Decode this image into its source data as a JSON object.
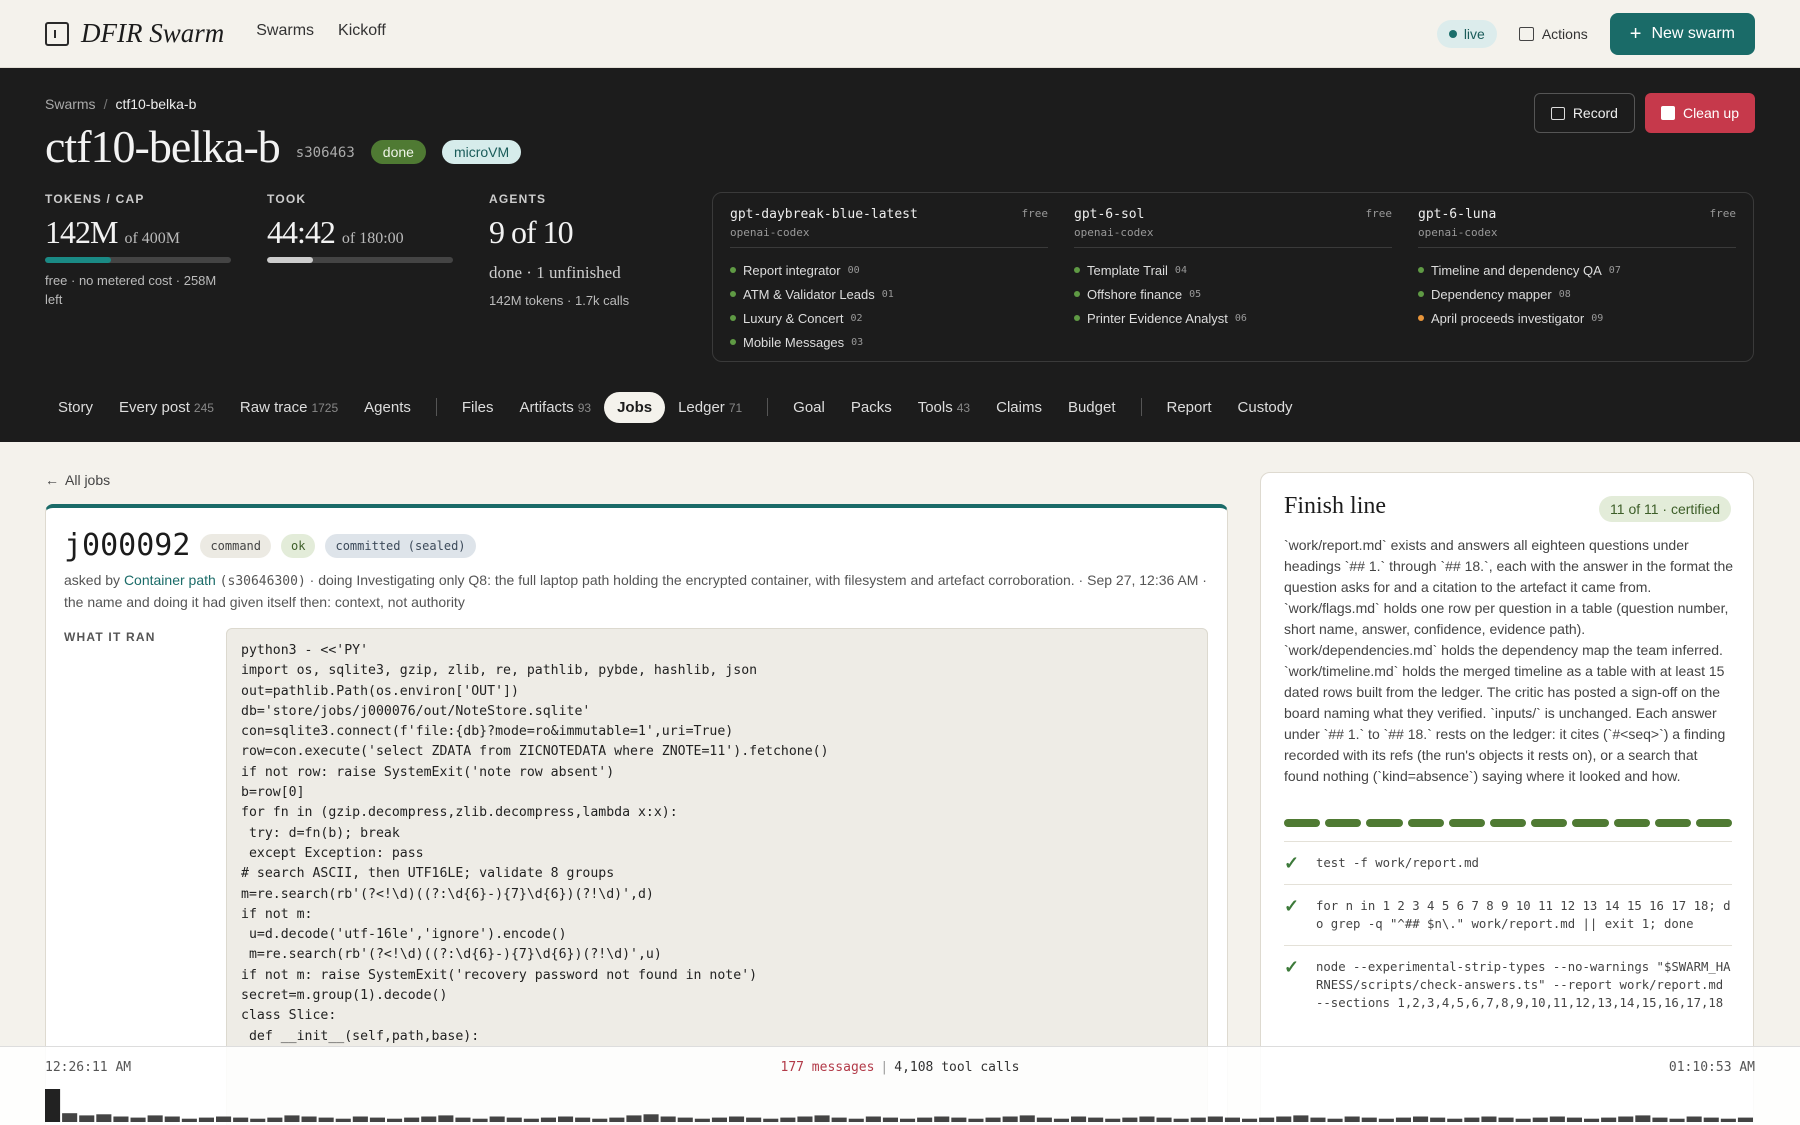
{
  "nav": {
    "logo": "DFIR Swarm",
    "links": [
      "Swarms",
      "Kickoff"
    ],
    "live": "live",
    "actions": "Actions",
    "new_swarm": "New swarm"
  },
  "hero": {
    "breadcrumb_root": "Swarms",
    "breadcrumb_sep": "/",
    "breadcrumb_current": "ctf10-belka-b",
    "title": "ctf10-belka-b",
    "swarm_id": "s306463",
    "status": "done",
    "runtime": "microVM",
    "record": "Record",
    "cleanup": "Clean up",
    "stats": {
      "tokens_label": "TOKENS / CAP",
      "tokens_value": "142M",
      "tokens_of": "of 400M",
      "tokens_fraction": 0.355,
      "tokens_sub": "free · no metered cost · 258M left",
      "took_label": "TOOK",
      "took_value": "44:42",
      "took_of": "of 180:00",
      "took_fraction": 0.248,
      "agents_label": "AGENTS",
      "agents_value": "9 of 10",
      "agents_sub": "done · 1 unfinished",
      "agents_sub2": "142M tokens · 1.7k calls"
    },
    "models": [
      {
        "name": "gpt-daybreak-blue-latest",
        "vendor": "openai-codex",
        "free": "free",
        "agents": [
          {
            "label": "Report integrator",
            "num": "00",
            "color": "#5f9a44"
          },
          {
            "label": "ATM & Validator Leads",
            "num": "01",
            "color": "#5f9a44"
          },
          {
            "label": "Luxury & Concert",
            "num": "02",
            "color": "#5f9a44"
          },
          {
            "label": "Mobile Messages",
            "num": "03",
            "color": "#5f9a44"
          }
        ]
      },
      {
        "name": "gpt-6-sol",
        "vendor": "openai-codex",
        "free": "free",
        "agents": [
          {
            "label": "Template Trail",
            "num": "04",
            "color": "#5f9a44"
          },
          {
            "label": "Offshore finance",
            "num": "05",
            "color": "#5f9a44"
          },
          {
            "label": "Printer Evidence Analyst",
            "num": "06",
            "color": "#5f9a44"
          }
        ]
      },
      {
        "name": "gpt-6-luna",
        "vendor": "openai-codex",
        "free": "free",
        "agents": [
          {
            "label": "Timeline and dependency QA",
            "num": "07",
            "color": "#5f9a44"
          },
          {
            "label": "Dependency mapper",
            "num": "08",
            "color": "#5f9a44"
          },
          {
            "label": "April proceeds investigator",
            "num": "09",
            "color": "#e8953a"
          }
        ]
      }
    ],
    "tabs": [
      {
        "label": "Story",
        "count": ""
      },
      {
        "label": "Every post",
        "count": "245"
      },
      {
        "label": "Raw trace",
        "count": "1725"
      },
      {
        "label": "Agents",
        "count": ""
      },
      {
        "sep": true
      },
      {
        "label": "Files",
        "count": ""
      },
      {
        "label": "Artifacts",
        "count": "93"
      },
      {
        "label": "Jobs",
        "count": "",
        "active": true
      },
      {
        "label": "Ledger",
        "count": "71"
      },
      {
        "sep": true
      },
      {
        "label": "Goal",
        "count": ""
      },
      {
        "label": "Packs",
        "count": ""
      },
      {
        "label": "Tools",
        "count": "43"
      },
      {
        "label": "Claims",
        "count": ""
      },
      {
        "label": "Budget",
        "count": ""
      },
      {
        "sep": true
      },
      {
        "label": "Report",
        "count": ""
      },
      {
        "label": "Custody",
        "count": ""
      }
    ]
  },
  "job": {
    "back": "All jobs",
    "id": "j000092",
    "kind": "command",
    "result": "ok",
    "state": "committed (sealed)",
    "meta_prefix": "asked by",
    "meta_agent": "Container path",
    "meta_agent_id": "(s30646300)",
    "meta_rest": "· doing Investigating only Q8: the full laptop path holding the encrypted container, with filesystem and artefact corroboration. · Sep 27, 12:36 AM · the name and doing it had given itself then: context, not authority",
    "ran_label": "WHAT IT RAN",
    "code": "python3 - <<'PY'\nimport os, sqlite3, gzip, zlib, re, pathlib, pybde, hashlib, json\nout=pathlib.Path(os.environ['OUT'])\ndb='store/jobs/j000076/out/NoteStore.sqlite'\ncon=sqlite3.connect(f'file:{db}?mode=ro&immutable=1',uri=True)\nrow=con.execute('select ZDATA from ZICNOTEDATA where ZNOTE=11').fetchone()\nif not row: raise SystemExit('note row absent')\nb=row[0]\nfor fn in (gzip.decompress,zlib.decompress,lambda x:x):\n try: d=fn(b); break\n except Exception: pass\n# search ASCII, then UTF16LE; validate 8 groups\nm=re.search(rb'(?<!\\d)((?:\\d{6}-){7}\\d{6})(?!\\d)',d)\nif not m:\n u=d.decode('utf-16le','ignore').encode()\n m=re.search(rb'(?<!\\d)((?:\\d{6}-){7}\\d{6})(?!\\d)',u)\nif not m: raise SystemExit('recovery password not found in note')\nsecret=m.group(1).decode()\nclass Slice:\n def __init__(self,path,base):"
  },
  "finish": {
    "title": "Finish line",
    "certified": "11 of 11 · certified",
    "text": "`work/report.md` exists and answers all eighteen questions under headings `## 1.` through `## 18.`, each with the answer in the format the question asks for and a citation to the artefact it came from. `work/flags.md` holds one row per question in a table (question number, short name, answer, confidence, evidence path). `work/dependencies.md` holds the dependency map the team inferred. `work/timeline.md` holds the merged timeline as a table with at least 15 dated rows built from the ledger. The critic has posted a sign-off on the board naming what they verified. `inputs/` is unchanged. Each answer under `## 1.` to `## 18.` rests on the ledger: it cites (`#<seq>`) a finding recorded with its refs (the run's objects it rests on), or a search that found nothing (`kind=absence`) saying where it looked and how.",
    "segments": 11,
    "checks": [
      "test -f work/report.md",
      "for n in 1 2 3 4 5 6 7 8 9 10 11 12 13 14 15 16 17 18; do grep -q \"^## $n\\.\" work/report.md || exit 1; done",
      "node --experimental-strip-types --no-warnings \"$SWARM_HARNESS/scripts/check-answers.ts\" --report work/report.md --sections 1,2,3,4,5,6,7,8,9,10,11,12,13,14,15,16,17,18"
    ]
  },
  "timeline": {
    "start": "12:26:11 AM",
    "end": "01:10:53 AM",
    "messages": "177 messages",
    "sep": "|",
    "calls": "4,108 tool calls",
    "activity": [
      30,
      8,
      6,
      7,
      5,
      4,
      6,
      5,
      3,
      4,
      5,
      4,
      3,
      4,
      6,
      5,
      4,
      3,
      5,
      4,
      3,
      4,
      5,
      6,
      4,
      3,
      5,
      4,
      3,
      4,
      5,
      4,
      3,
      4,
      6,
      7,
      5,
      4,
      3,
      4,
      5,
      4,
      3,
      4,
      5,
      6,
      4,
      3,
      5,
      4,
      3,
      4,
      5,
      4,
      3,
      4,
      5,
      6,
      4,
      3,
      5,
      4,
      3,
      4,
      5,
      4,
      3,
      4,
      5,
      4,
      3,
      4,
      5,
      6,
      4,
      3,
      5,
      4,
      3,
      4,
      5,
      4,
      3,
      4,
      5,
      4,
      3,
      4,
      5,
      4,
      3,
      4,
      5,
      6,
      4,
      3,
      5,
      4,
      3,
      4
    ]
  }
}
